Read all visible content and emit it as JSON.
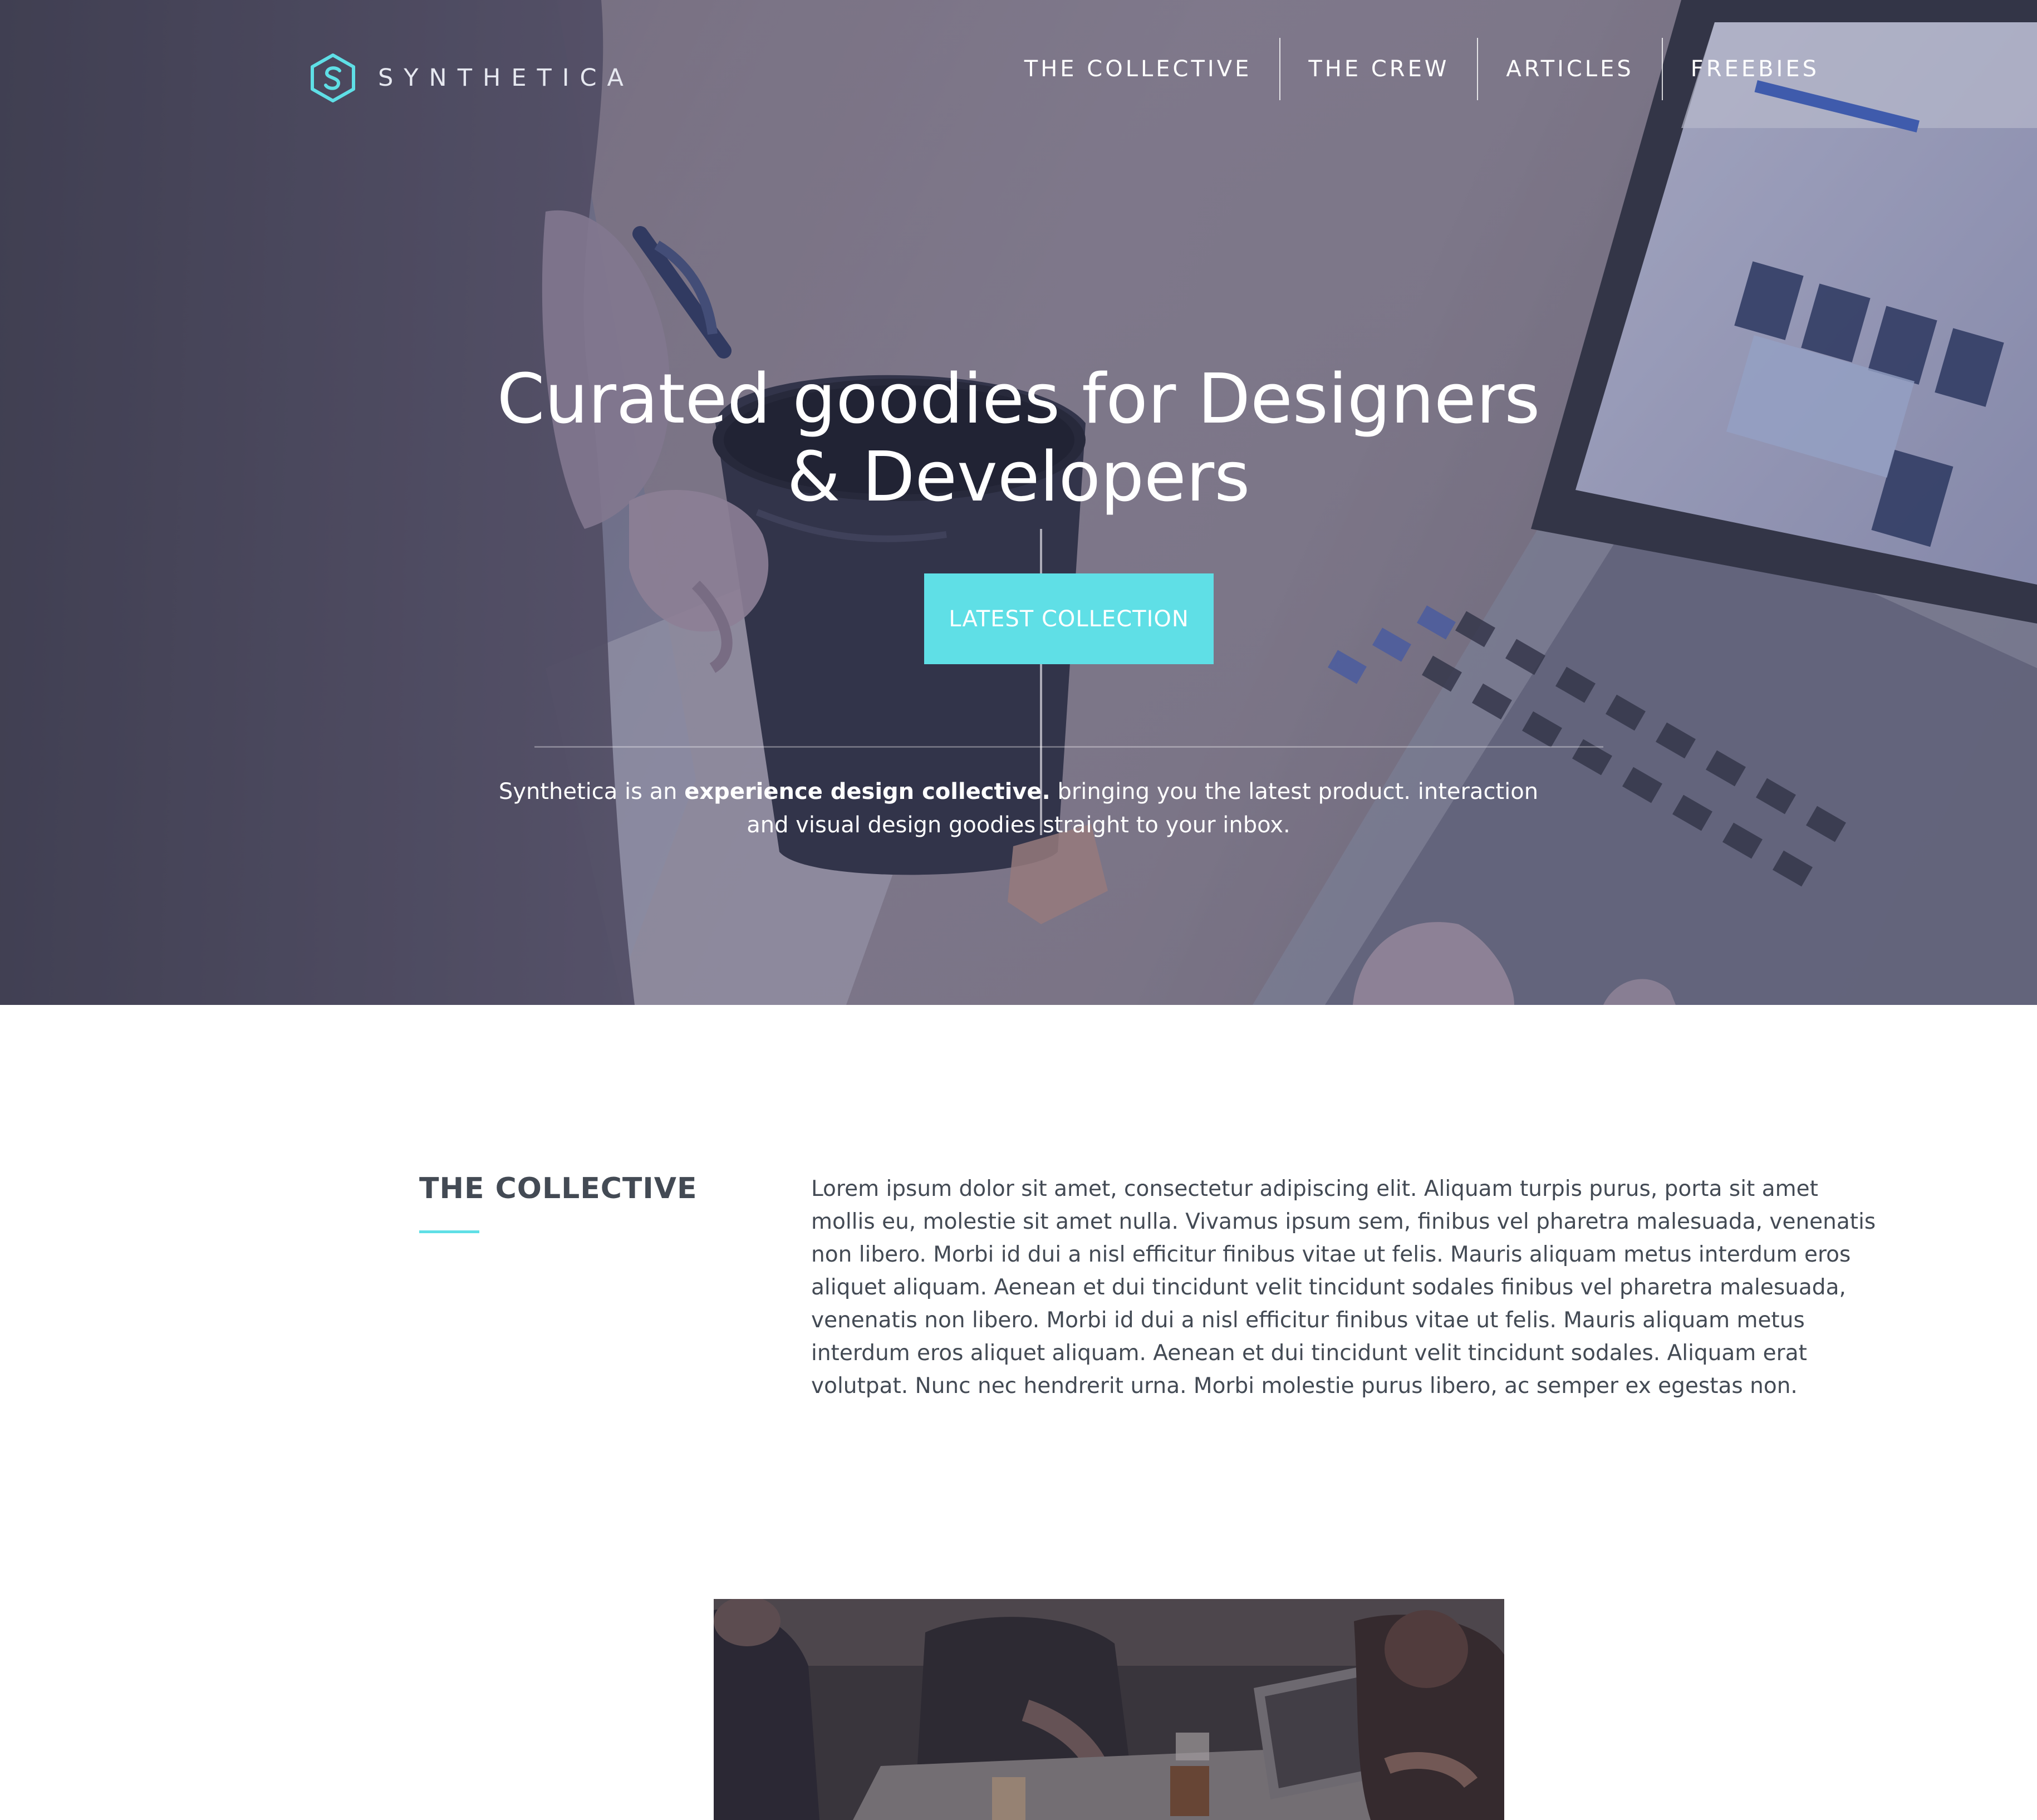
{
  "brand": {
    "name": "SYNTHETICA",
    "accent_color": "#5fdfe6",
    "logo_icon": "hexagon-s-logo-icon"
  },
  "nav": {
    "items": [
      {
        "label": "THE COLLECTIVE"
      },
      {
        "label": "THE CREW"
      },
      {
        "label": "ARTICLES"
      },
      {
        "label": "FREEBIES"
      }
    ]
  },
  "hero": {
    "title_line1": "Curated goodies for Designers",
    "title_line2": "& Developers",
    "cta_label": "LATEST COLLECTION",
    "desc_prefix": "Synthetica is an ",
    "desc_bold": "experience design collective.",
    "desc_suffix": " bringing you the latest product. interaction",
    "desc_line2": "and visual design goodies straight to your inbox.",
    "background_image": "woman-drinking-tea-at-laptop-photo"
  },
  "collective": {
    "title": "THE COLLECTIVE",
    "body": "Lorem ipsum dolor sit amet, consectetur adipiscing elit. Aliquam turpis purus, porta sit amet mollis eu, molestie sit amet nulla. Vivamus ipsum sem, finibus vel pharetra malesuada, venenatis non libero. Morbi id dui a nisl efficitur finibus vitae ut felis. Mauris aliquam metus interdum eros aliquet aliquam. Aenean et dui tincidunt velit tincidunt sodales finibus vel pharetra malesuada, venenatis non libero. Morbi id dui a nisl efficitur finibus vitae ut felis. Mauris aliquam metus interdum eros aliquet aliquam. Aenean et dui tincidunt velit tincidunt sodales. Aliquam erat volutpat. Nunc nec hendrerit urna. Morbi molestie purus libero, ac semper ex egestas non."
  },
  "team_photo": {
    "image": "team-working-at-table-photo"
  }
}
